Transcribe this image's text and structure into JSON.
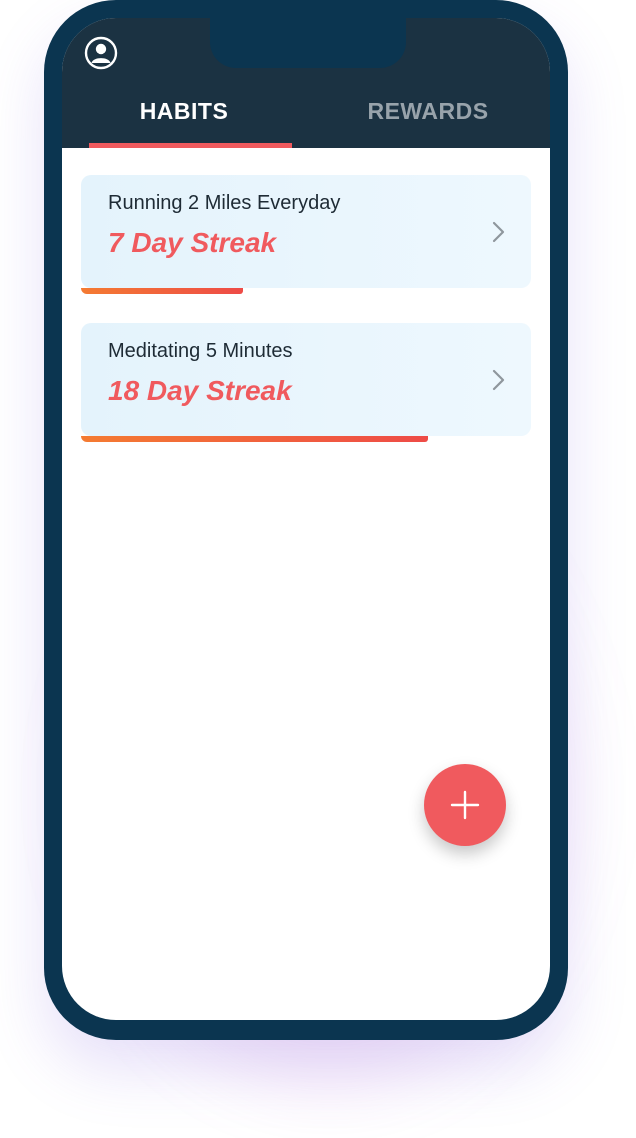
{
  "tabs": {
    "habits_label": "HABITS",
    "rewards_label": "REWARDS",
    "active": "HABITS"
  },
  "habits": [
    {
      "name": "Running 2 Miles Everyday",
      "streak": "7 Day Streak",
      "progress": 0.36
    },
    {
      "name": "Meditating 5 Minutes",
      "streak": "18 Day Streak",
      "progress": 0.77
    }
  ],
  "icons": {
    "profile": "user-circle-icon",
    "chevron": "chevron-right-icon",
    "add": "plus-icon"
  },
  "colors": {
    "accent": "#f05a5e",
    "header_bg": "#1b3242",
    "phone_frame": "#0b3550",
    "card_bg": "#e4f3fc",
    "progress_start": "#f47b32",
    "progress_end": "#ee4b47",
    "inactive_tab": "#98a3ab"
  }
}
